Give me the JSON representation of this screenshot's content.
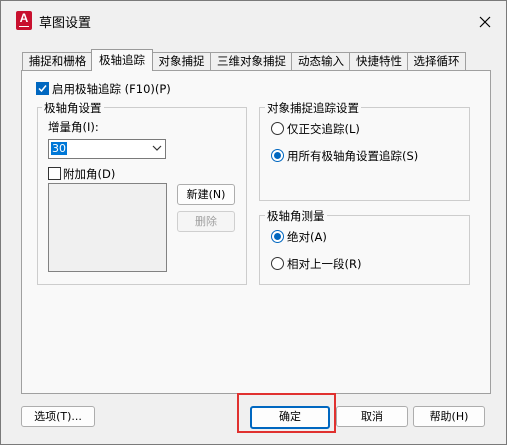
{
  "window": {
    "title": "草图设置",
    "app_icon_letter": "A"
  },
  "tabs": [
    {
      "label": "捕捉和栅格",
      "active": false
    },
    {
      "label": "极轴追踪",
      "active": true
    },
    {
      "label": "对象捕捉",
      "active": false
    },
    {
      "label": "三维对象捕捉",
      "active": false
    },
    {
      "label": "动态输入",
      "active": false
    },
    {
      "label": "快捷特性",
      "active": false
    },
    {
      "label": "选择循环",
      "active": false
    }
  ],
  "polar": {
    "enable_label": "启用极轴追踪 (F10)(P)",
    "enable_checked": true,
    "angle_settings": {
      "title": "极轴角设置",
      "increment_label": "增量角(I):",
      "increment_value": "30",
      "additional_label": "附加角(D)",
      "additional_checked": false,
      "new_button": "新建(N)",
      "delete_button": "删除"
    },
    "snap_tracking": {
      "title": "对象捕捉追踪设置",
      "options": [
        {
          "label": "仅正交追踪(L)",
          "checked": false
        },
        {
          "label": "用所有极轴角设置追踪(S)",
          "checked": true
        }
      ]
    },
    "measurement": {
      "title": "极轴角测量",
      "options": [
        {
          "label": "绝对(A)",
          "checked": true
        },
        {
          "label": "相对上一段(R)",
          "checked": false
        }
      ]
    }
  },
  "footer": {
    "options_button": "选项(T)...",
    "ok_button": "确定",
    "cancel_button": "取消",
    "help_button": "帮助(H)"
  },
  "colors": {
    "accent": "#0067c0",
    "app_icon": "#c8102e",
    "highlight": "#e0312f"
  }
}
